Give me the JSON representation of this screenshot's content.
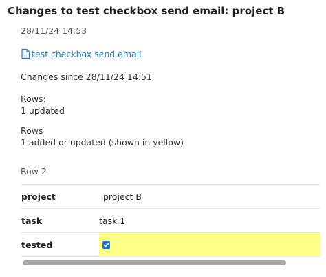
{
  "header": {
    "title": "Changes to test checkbox send email: project B",
    "timestamp": "28/11/24 14:53"
  },
  "document_link": {
    "icon": "document-icon",
    "label": "test checkbox send email"
  },
  "changes_since": "Changes since 28/11/24 14:51",
  "rows_summary": {
    "heading": "Rows:",
    "detail": "1 updated"
  },
  "rows_detail": {
    "heading": "Rows",
    "detail": "1 added or updated (shown in yellow)"
  },
  "record": {
    "heading": "Row 2",
    "fields": [
      {
        "label": "project",
        "value": "project B"
      },
      {
        "label": "task",
        "value": "task 1"
      },
      {
        "label": "tested",
        "value": "",
        "checked": true,
        "highlight_color": "#ffff88"
      }
    ]
  },
  "colors": {
    "link": "#2f7fc0",
    "checkbox": "#1a73e8",
    "highlight": "#ffff88"
  }
}
